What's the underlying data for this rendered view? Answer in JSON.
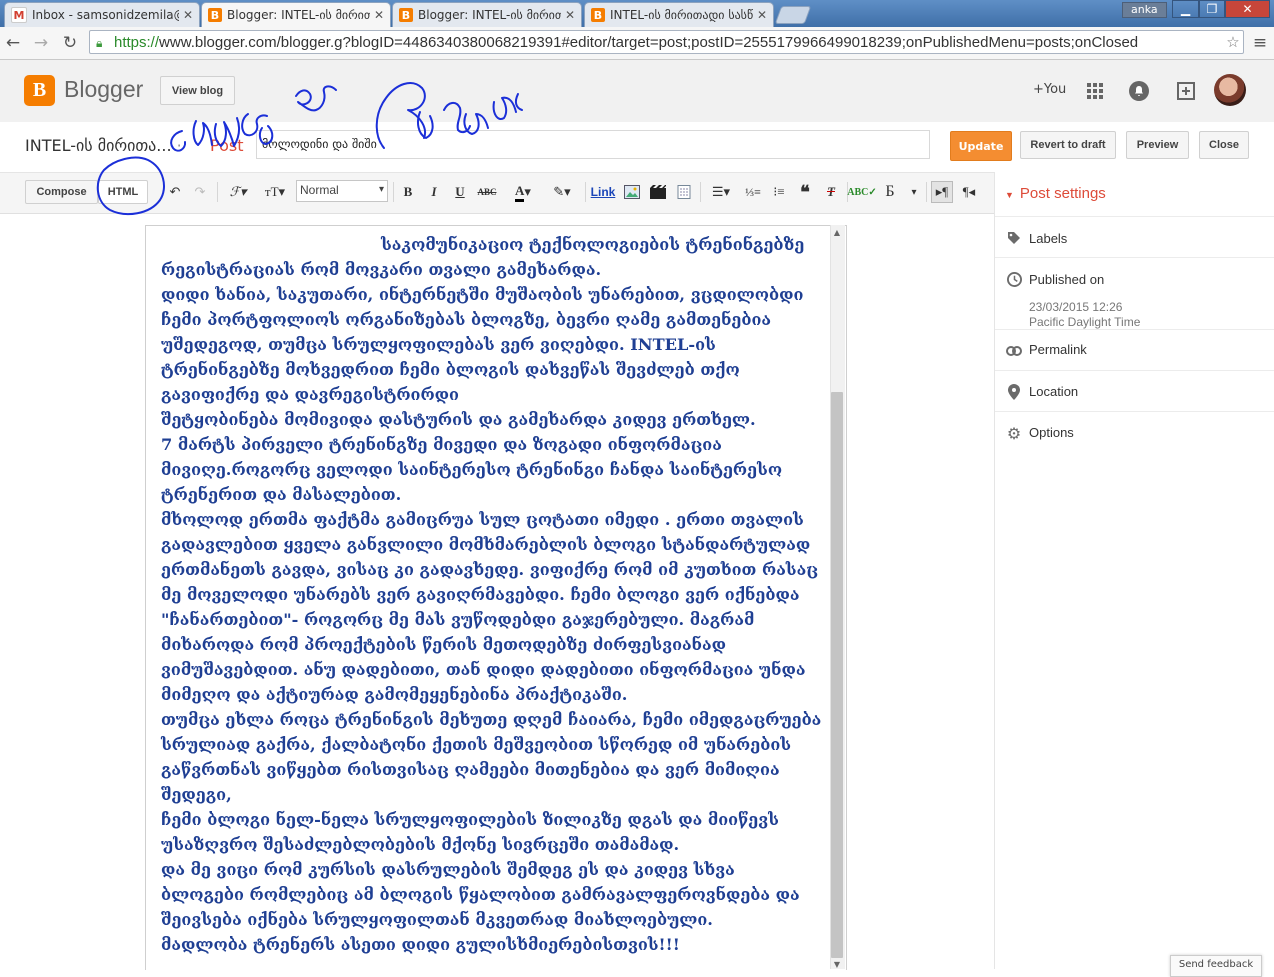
{
  "browser": {
    "tabs": [
      {
        "title": "Inbox - samsonidzemila@",
        "icon": "gmail-icon",
        "active": false
      },
      {
        "title": "Blogger: INTEL-ის მირით...",
        "icon": "blogger-icon",
        "active": true
      },
      {
        "title": "Blogger: INTEL-ის მირით...",
        "icon": "blogger-icon",
        "active": false
      },
      {
        "title": "INTEL-ის მირითადი სასწ",
        "icon": "blogger-icon",
        "active": false
      }
    ],
    "user_badge": "anka",
    "url_scheme": "https://",
    "url_rest": "www.blogger.com/blogger.g?blogID=4486340380068219391#editor/target=post;postID=2555179966499018239;onPublishedMenu=posts;onClosed"
  },
  "header": {
    "logo_text": "Blogger",
    "view_blog": "View blog",
    "plus_you": "+You"
  },
  "title_row": {
    "blog_name": "INTEL-ის მირითა...",
    "separator": "·",
    "post_label": "Post",
    "post_title": "მოლოდინი და შიში",
    "update": "Update",
    "revert": "Revert to draft",
    "preview": "Preview",
    "close": "Close"
  },
  "toolbar": {
    "compose": "Compose",
    "html": "HTML",
    "font_size": "Normal",
    "link": "Link",
    "lang": "Б"
  },
  "editor": {
    "paragraphs": [
      {
        "text": "საკომუნიკაციო ტექნოლოგიების ტრენინგებზე",
        "indent": true
      },
      {
        "text": "რეგისტრაციას რომ მოვკარი თვალი გამეხარდა."
      },
      {
        "text": "დიდი ხანია,  საკუთარი, ინტერნეტში მუშაობის უნარებით, ვცდილობდი ჩემი პორტფოლიოს ორგანიზებას ბლოგზე, ბევრი ღამე გამთენებია უშედეგოდ, თუმცა სრულყოფილებას ვერ ვიღებდი. INTEL-ის ტრენინგებზე მოხვედრით ჩემი ბლოგის დახვეწას შევძლებ თქო გავიფიქრე და დავრეგისტრირდი"
      },
      {
        "text": "შეტყობინება მომივიდა დასტურის და გამეხარდა კიდევ ერთხელ."
      },
      {
        "text": "7 მარტს პირველი ტრენინგზე მივედი და ზოგადი ინფორმაცია მივიღე.როგორც ველოდი  საინტერესო ტრენინგი ჩანდა საინტერესო ტრენერით და მასალებით."
      },
      {
        "text": "მხოლოდ ერთმა ფაქტმა გამიცრუა სულ ცოტათი იმედი . ერთი თვალის გადავლებით ყველა განვლილი მომხმარებლის ბლოგი სტანდარტულად ერთმანეთს გავდა, ვისაც კი გადავხედე. ვიფიქრე რომ იმ კუთხით რასაც მე მოველოდი უნარებს ვერ გავიღრმავებდი. ჩემი ბლოგი ვერ იქნებდა \"ჩანართებით\"- როგორც მე მას ვუწოდებდი გაჯერებული. მაგრამ მიხაროდა რომ პროექტების წერის მეთოდებზე ძირფესვიანად ვიმუშავებდით. ანუ დადებითი, თან დიდი დადებითი ინფორმაცია უნდა მიმეღო და აქტიურად გამომეყენებინა პრაქტიკაში."
      },
      {
        "text": "თუმცა ეხლა როცა ტრენინგის მეხუთე დღემ ჩაიარა, ჩემი იმედგაცრუება სრულიად გაქრა, ქალბატონი ქეთის მეშვეობით სწორედ იმ უნარების გაწვრთნას ვიწყებთ რისთვისაც ღამეები მითენებია და ვერ მიმიღია შედეგი,"
      },
      {
        "text": "ჩემი ბლოგი ნელ-ნელა სრულყოფილების ზილიკზე დგას და მიიწევს უსაზღვრო შესაძლებლობების მქონე სივრცეში თამამად."
      },
      {
        "text": "და მე ვიცი რომ კურსის დასრულების შემდეგ ეს და კიდევ სხვა ბლოგები რომლებიც ამ ბლოგის წყალობით გამრავალფეროვნდება და შეივსება იქნება სრულყოფილთან მკვეთრად მიახლოებული."
      },
      {
        "text": "მადლობა ტრენერს ასეთი დიდი გულისხმიერებისთვის!!!"
      }
    ]
  },
  "sidebar": {
    "heading": "Post settings",
    "items": [
      {
        "label": "Labels",
        "icon": "tag-icon"
      },
      {
        "label": "Published on",
        "icon": "clock-icon",
        "date": "23/03/2015 12:26",
        "timezone": "Pacific Daylight Time"
      },
      {
        "label": "Permalink",
        "icon": "link-icon"
      },
      {
        "label": "Location",
        "icon": "pin-icon"
      },
      {
        "label": "Options",
        "icon": "gear-icon"
      }
    ]
  },
  "feedback": "Send feedback"
}
